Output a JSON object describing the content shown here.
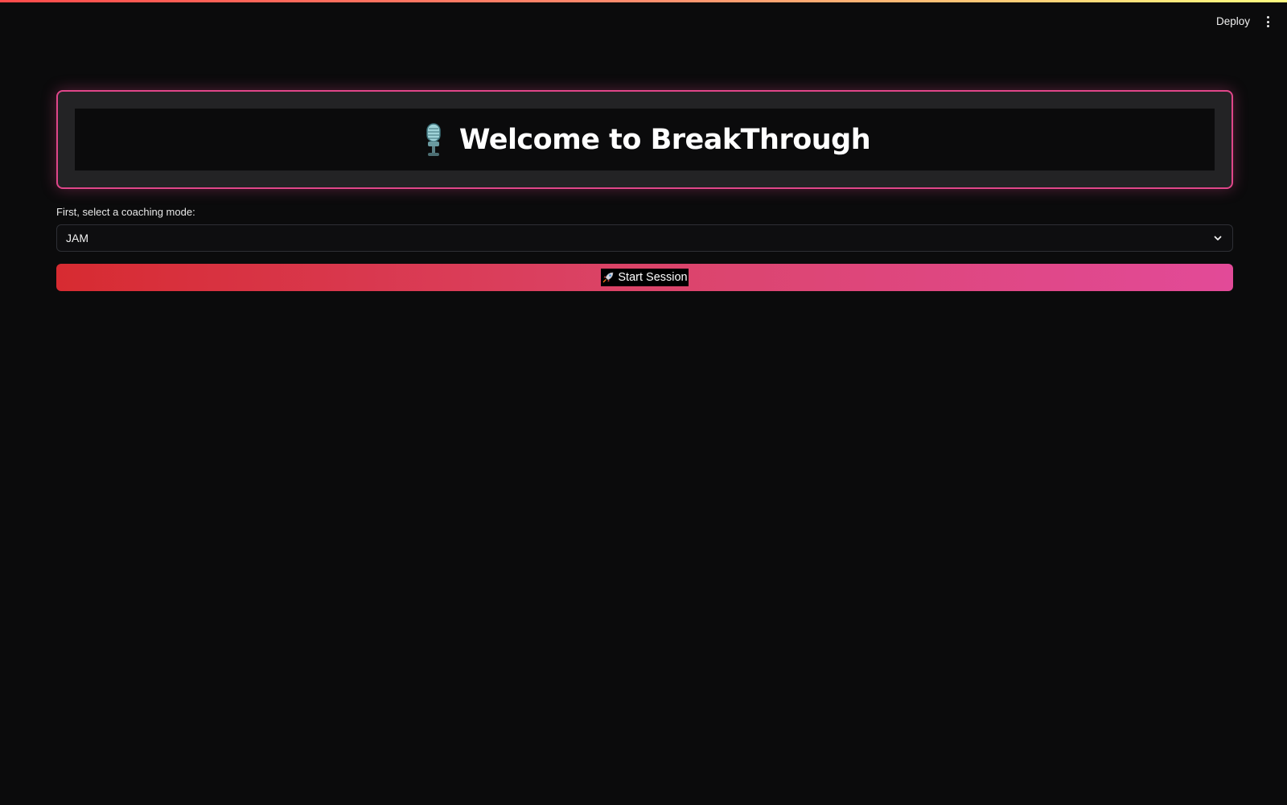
{
  "header": {
    "deploy_label": "Deploy",
    "menu_icon": "vertical-ellipsis-icon"
  },
  "hero": {
    "icon": "microphone-icon",
    "title": "Welcome to BreakThrough",
    "border_color": "#e0468a"
  },
  "mode_select": {
    "label": "First, select a coaching mode:",
    "value": "JAM",
    "icon": "chevron-down-icon"
  },
  "start_button": {
    "icon": "rocket-icon",
    "label": "Start Session",
    "gradient_start": "#d72b31",
    "gradient_end": "#e24a98"
  }
}
